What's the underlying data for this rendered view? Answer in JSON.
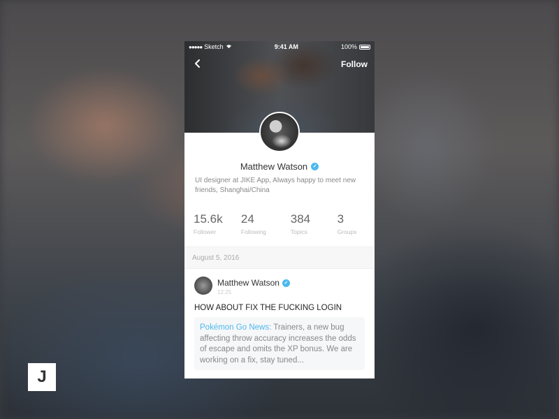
{
  "status_bar": {
    "carrier": "Sketch",
    "signal_dots": "●●●●●",
    "time": "9:41 AM",
    "battery": "100%"
  },
  "nav": {
    "back_icon": "chevron-left-icon",
    "back_glyph": "‹",
    "follow_label": "Follow"
  },
  "profile": {
    "name": "Matthew Watson",
    "verified_glyph": "✓",
    "bio": "UI designer at JIKE App, Always happy to meet new friends, Shanghai/China",
    "stats": [
      {
        "value": "15.6k",
        "label": "Follower"
      },
      {
        "value": "24",
        "label": "Following"
      },
      {
        "value": "384",
        "label": "Topics"
      },
      {
        "value": "3",
        "label": "Groups"
      }
    ]
  },
  "feed": {
    "date": "August 5, 2016",
    "post": {
      "author": "Matthew Watson",
      "time": "12:25",
      "title": "HOW ABOUT FIX THE FUCKING LOGIN",
      "quote_source": "Pokémon Go News:",
      "quote_text": " Trainers, a new bug affecting throw accuracy increases the odds of escape and omits the XP bonus. We are working on a fix, stay tuned..."
    }
  },
  "brand": {
    "logo_letter": "J"
  },
  "colors": {
    "accent": "#4db8ef",
    "text_primary": "#333333",
    "text_secondary": "#888888"
  }
}
